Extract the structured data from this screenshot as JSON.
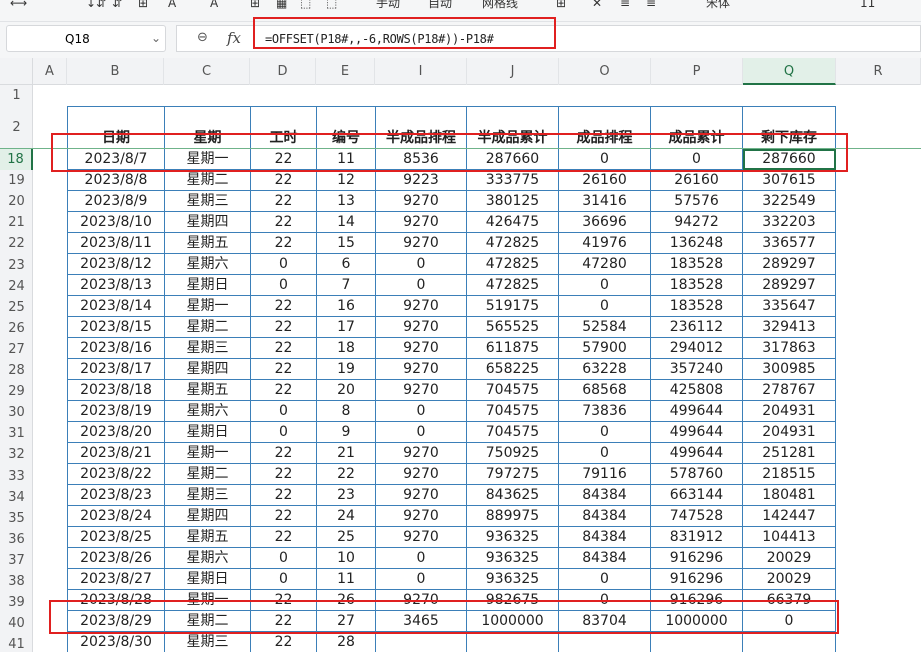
{
  "toolbar": {
    "items": [
      "⟷",
      "↓⇵",
      "⇵",
      "⊞",
      "A",
      "A",
      "⊞",
      "▦",
      "⬚",
      "⬚",
      "手动",
      "自动",
      "网格线",
      "⊞",
      "✕",
      "≡",
      "≡",
      "宋体",
      "11"
    ]
  },
  "namebox": {
    "value": "Q18"
  },
  "formula_bar": {
    "fx": "fx",
    "formula": "=OFFSET(P18#,,-6,ROWS(P18#))-P18#"
  },
  "columns": [
    "A",
    "B",
    "C",
    "D",
    "E",
    "I",
    "J",
    "O",
    "P",
    "Q",
    "R"
  ],
  "selected_column": "Q",
  "selected_row": "18",
  "row_numbers": [
    "1",
    "2",
    "18",
    "19",
    "20",
    "21",
    "22",
    "23",
    "24",
    "25",
    "26",
    "27",
    "28",
    "29",
    "30",
    "31",
    "32",
    "33",
    "34",
    "35",
    "36",
    "37",
    "38",
    "39",
    "40",
    "41"
  ],
  "table": {
    "headers": [
      "日期",
      "星期",
      "工时",
      "编号",
      "半成品排程",
      "半成品累计",
      "成品排程",
      "成品累计",
      "剩下库存"
    ],
    "rows": [
      [
        "2023/8/7",
        "星期一",
        "22",
        "11",
        "8536",
        "287660",
        "0",
        "0",
        "287660"
      ],
      [
        "2023/8/8",
        "星期二",
        "22",
        "12",
        "9223",
        "333775",
        "26160",
        "26160",
        "307615"
      ],
      [
        "2023/8/9",
        "星期三",
        "22",
        "13",
        "9270",
        "380125",
        "31416",
        "57576",
        "322549"
      ],
      [
        "2023/8/10",
        "星期四",
        "22",
        "14",
        "9270",
        "426475",
        "36696",
        "94272",
        "332203"
      ],
      [
        "2023/8/11",
        "星期五",
        "22",
        "15",
        "9270",
        "472825",
        "41976",
        "136248",
        "336577"
      ],
      [
        "2023/8/12",
        "星期六",
        "0",
        "6",
        "0",
        "472825",
        "47280",
        "183528",
        "289297"
      ],
      [
        "2023/8/13",
        "星期日",
        "0",
        "7",
        "0",
        "472825",
        "0",
        "183528",
        "289297"
      ],
      [
        "2023/8/14",
        "星期一",
        "22",
        "16",
        "9270",
        "519175",
        "0",
        "183528",
        "335647"
      ],
      [
        "2023/8/15",
        "星期二",
        "22",
        "17",
        "9270",
        "565525",
        "52584",
        "236112",
        "329413"
      ],
      [
        "2023/8/16",
        "星期三",
        "22",
        "18",
        "9270",
        "611875",
        "57900",
        "294012",
        "317863"
      ],
      [
        "2023/8/17",
        "星期四",
        "22",
        "19",
        "9270",
        "658225",
        "63228",
        "357240",
        "300985"
      ],
      [
        "2023/8/18",
        "星期五",
        "22",
        "20",
        "9270",
        "704575",
        "68568",
        "425808",
        "278767"
      ],
      [
        "2023/8/19",
        "星期六",
        "0",
        "8",
        "0",
        "704575",
        "73836",
        "499644",
        "204931"
      ],
      [
        "2023/8/20",
        "星期日",
        "0",
        "9",
        "0",
        "704575",
        "0",
        "499644",
        "204931"
      ],
      [
        "2023/8/21",
        "星期一",
        "22",
        "21",
        "9270",
        "750925",
        "0",
        "499644",
        "251281"
      ],
      [
        "2023/8/22",
        "星期二",
        "22",
        "22",
        "9270",
        "797275",
        "79116",
        "578760",
        "218515"
      ],
      [
        "2023/8/23",
        "星期三",
        "22",
        "23",
        "9270",
        "843625",
        "84384",
        "663144",
        "180481"
      ],
      [
        "2023/8/24",
        "星期四",
        "22",
        "24",
        "9270",
        "889975",
        "84384",
        "747528",
        "142447"
      ],
      [
        "2023/8/25",
        "星期五",
        "22",
        "25",
        "9270",
        "936325",
        "84384",
        "831912",
        "104413"
      ],
      [
        "2023/8/26",
        "星期六",
        "0",
        "10",
        "0",
        "936325",
        "84384",
        "916296",
        "20029"
      ],
      [
        "2023/8/27",
        "星期日",
        "0",
        "11",
        "0",
        "936325",
        "0",
        "916296",
        "20029"
      ],
      [
        "2023/8/28",
        "星期一",
        "22",
        "26",
        "9270",
        "982675",
        "0",
        "916296",
        "66379"
      ],
      [
        "2023/8/29",
        "星期二",
        "22",
        "27",
        "3465",
        "1000000",
        "83704",
        "1000000",
        "0"
      ],
      [
        "2023/8/30",
        "星期三",
        "22",
        "28",
        "",
        "",
        "",
        "",
        ""
      ]
    ]
  },
  "colors": {
    "highlight": "#e02020",
    "selection": "#217346",
    "table_border": "#3b7fb8"
  }
}
